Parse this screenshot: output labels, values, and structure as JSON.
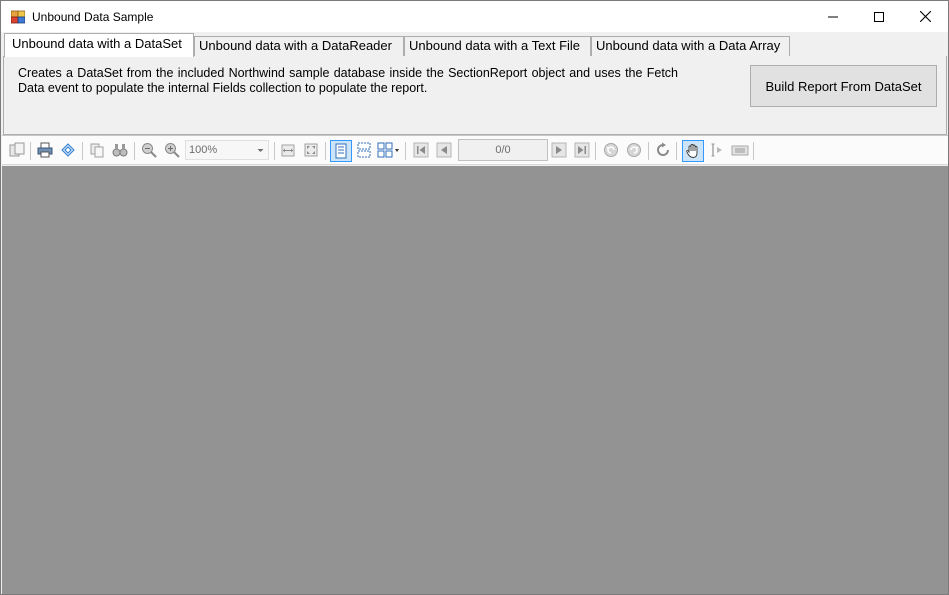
{
  "window": {
    "title": "Unbound Data Sample"
  },
  "tabs": [
    {
      "label": "Unbound data with a  DataSet",
      "active": true
    },
    {
      "label": "Unbound data with a DataReader",
      "active": false
    },
    {
      "label": "Unbound data with a Text File",
      "active": false
    },
    {
      "label": "Unbound data with a Data Array",
      "active": false
    }
  ],
  "panel": {
    "description": "Creates a DataSet from the included Northwind sample database inside the SectionReport object and uses the Fetch Data event to populate the internal Fields collection to populate the report.",
    "build_button": "Build Report From DataSet"
  },
  "toolbar": {
    "zoom": "100%",
    "page_indicator": "0/0"
  },
  "colors": {
    "viewer_background": "#939393",
    "checked_highlight": "#cce4f7",
    "checked_border": "#3399ff"
  }
}
